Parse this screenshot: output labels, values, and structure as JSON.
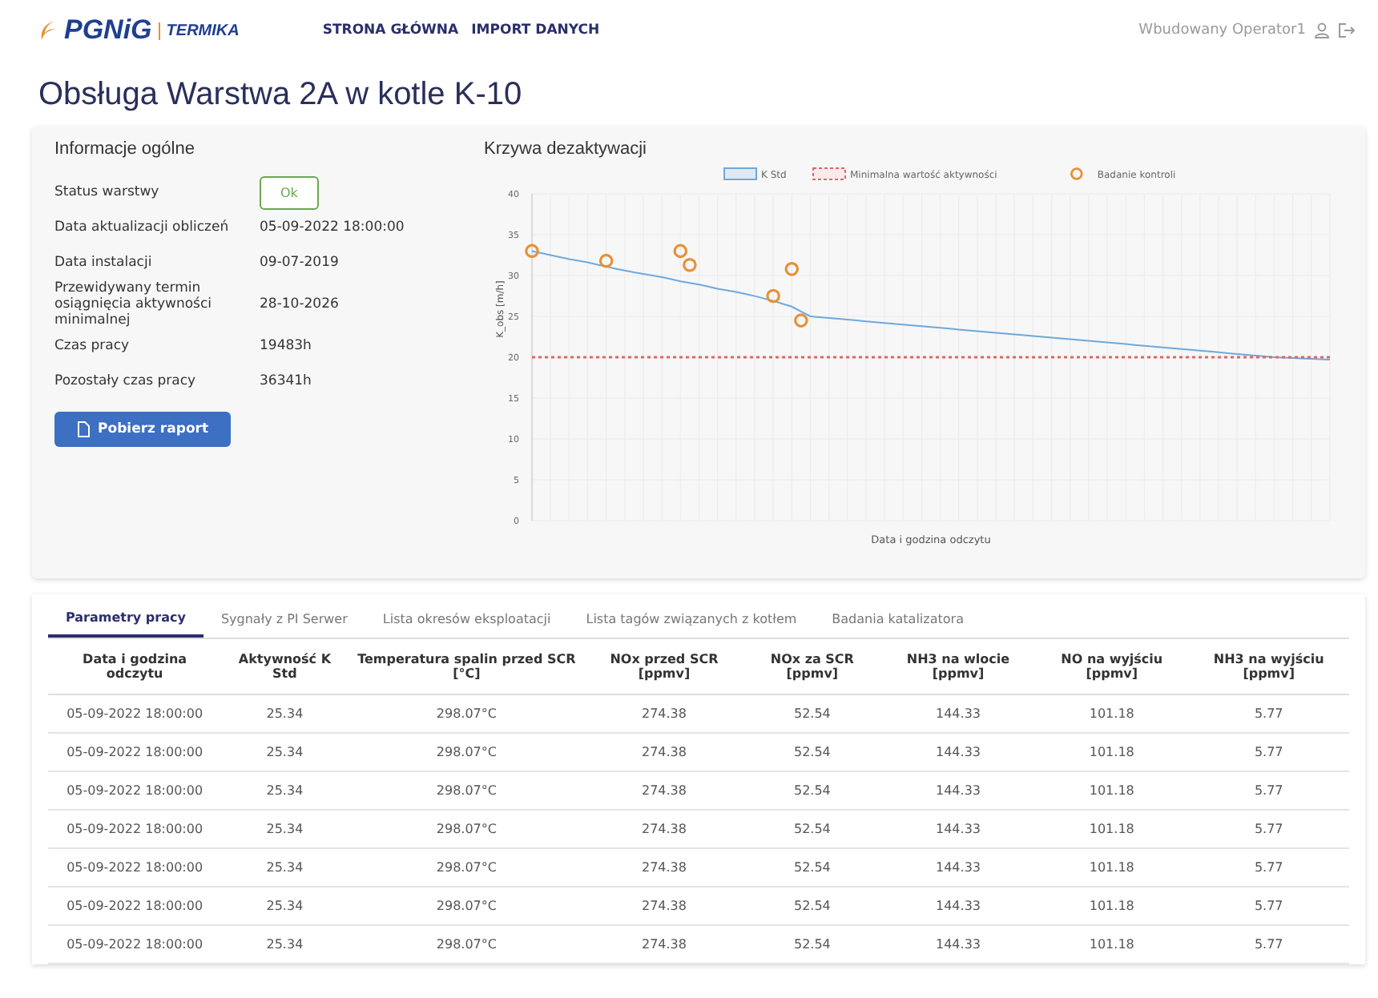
{
  "header": {
    "logo": {
      "brand": "PGNiG",
      "sub": "TERMIKA"
    },
    "nav": [
      {
        "label": "STRONA GŁÓWNA",
        "selected": false
      },
      {
        "label": "IMPORT DANYCH",
        "selected": false
      }
    ],
    "user": "Wbudowany Operator1"
  },
  "page_title": "Obsługa Warstwa 2A w kotle K-10",
  "info": {
    "title": "Informacje ogólne",
    "rows": [
      {
        "label": "Status warstwy",
        "value": "Ok",
        "kind": "badge"
      },
      {
        "label": "Data aktualizacji obliczeń",
        "value": "05-09-2022 18:00:00",
        "kind": "text"
      },
      {
        "label": "Data instalacji",
        "value": "09-07-2019",
        "kind": "text"
      },
      {
        "label": "Przewidywany termin osiągnięcia aktywności minimalnej",
        "value": "28-10-2026",
        "kind": "text"
      },
      {
        "label": "Czas pracy",
        "value": "19483h",
        "kind": "text"
      },
      {
        "label": "Pozostały czas pracy",
        "value": "36341h",
        "kind": "text"
      }
    ],
    "button": "Pobierz raport"
  },
  "chart": {
    "title": "Krzywa dezaktywacji",
    "chart_data": {
      "type": "line",
      "categories": [
        null,
        null,
        null,
        null,
        null,
        null,
        null,
        null,
        null,
        null,
        null,
        null,
        null,
        null,
        null,
        null,
        null,
        null,
        null,
        null,
        null,
        null,
        null,
        null,
        null,
        null,
        null,
        null,
        null,
        null,
        null,
        null,
        null,
        null,
        null,
        null,
        null,
        null,
        null,
        null,
        null,
        null,
        null,
        null,
        null,
        null,
        null,
        null,
        null,
        null,
        null,
        null,
        null,
        null,
        null,
        null,
        null,
        null,
        null,
        null,
        null,
        null,
        null,
        null,
        null,
        null,
        null,
        null,
        null,
        null,
        null,
        null,
        null,
        null,
        null,
        null,
        null,
        null,
        null,
        null,
        null,
        null,
        null,
        null,
        null,
        null,
        null
      ],
      "xlabel": "Data i godzina odczytu",
      "ylabel": "K_obs [m/h]",
      "ylim": [
        0,
        40
      ],
      "grid": true,
      "legend": true,
      "yticks": [
        0,
        5,
        10,
        15,
        20,
        25,
        30,
        35,
        40
      ],
      "series": [
        {
          "name": "K Std",
          "color": "#6fa8dc",
          "type": "line",
          "line_style": "solid",
          "values": [
            33,
            32.75,
            32.5,
            32.25,
            32,
            31.8,
            31.6,
            31.35,
            31.1,
            30.85,
            30.6,
            30.4,
            30.2,
            30,
            29.8,
            29.55,
            29.3,
            29.1,
            28.9,
            28.65,
            28.4,
            28.2,
            28,
            27.75,
            27.5,
            27.2,
            26.9,
            26.55,
            26.2,
            25.6,
            25,
            24.9,
            24.8,
            24.7,
            24.6,
            24.5,
            24.4,
            24.3,
            24.2,
            24.1,
            24,
            23.9,
            23.8,
            23.7,
            23.6,
            23.5,
            23.4,
            23.3,
            23.2,
            23.1,
            23,
            22.9,
            22.8,
            22.7,
            22.6,
            22.5,
            22.4,
            22.3,
            22.2,
            22.1,
            22,
            21.9,
            21.8,
            21.7,
            21.6,
            21.5,
            21.4,
            21.3,
            21.2,
            21.1,
            21,
            20.9,
            20.8,
            20.7,
            20.6,
            20.5,
            20.4,
            20.3,
            20.2,
            20.1,
            20,
            19.95,
            19.9,
            19.85,
            19.8,
            19.75,
            19.7
          ]
        },
        {
          "name": "Minimalna wartość aktywności",
          "color": "#e06666",
          "type": "line",
          "line_style": "dashed",
          "values": [
            20,
            20,
            20,
            20,
            20,
            20,
            20,
            20,
            20,
            20,
            20,
            20,
            20,
            20,
            20,
            20,
            20,
            20,
            20,
            20,
            20,
            20,
            20,
            20,
            20,
            20,
            20,
            20,
            20,
            20,
            20,
            20,
            20,
            20,
            20,
            20,
            20,
            20,
            20,
            20,
            20,
            20,
            20,
            20,
            20,
            20,
            20,
            20,
            20,
            20,
            20,
            20,
            20,
            20,
            20,
            20,
            20,
            20,
            20,
            20,
            20,
            20,
            20,
            20,
            20,
            20,
            20,
            20,
            20,
            20,
            20,
            20,
            20,
            20,
            20,
            20,
            20,
            20,
            20,
            20,
            20,
            20,
            20,
            20,
            20,
            20,
            20
          ]
        },
        {
          "name": "Badanie kontroli",
          "color": "#e69138",
          "type": "scatter",
          "values": [
            33,
            null,
            null,
            null,
            null,
            null,
            null,
            null,
            31.8,
            null,
            null,
            null,
            null,
            null,
            null,
            null,
            33,
            31.3,
            null,
            null,
            null,
            null,
            null,
            null,
            null,
            null,
            27.5,
            null,
            30.8,
            24.5,
            null,
            null,
            null,
            null,
            null,
            null,
            null,
            null,
            null,
            null,
            null,
            null,
            null,
            null,
            null,
            null,
            null,
            null,
            null,
            null,
            null,
            null,
            null,
            null,
            null,
            null,
            null,
            null,
            null,
            null,
            null,
            null,
            null,
            null,
            null,
            null,
            null,
            null,
            null,
            null,
            null,
            null,
            null,
            null,
            null,
            null,
            null,
            null,
            null,
            null,
            null,
            null,
            null,
            null,
            null,
            null,
            null
          ]
        }
      ]
    }
  },
  "tabs": [
    {
      "label": "Parametry pracy",
      "selected": true
    },
    {
      "label": "Sygnały z PI Serwer",
      "selected": false
    },
    {
      "label": "Lista okresów eksploatacji",
      "selected": false
    },
    {
      "label": "Lista tagów związanych z kotłem",
      "selected": false
    },
    {
      "label": "Badania katalizatora",
      "selected": false
    }
  ],
  "table": {
    "columns": [
      "Data i godzina odczytu",
      "Aktywność K Std",
      "Temperatura spalin przed SCR [°C]",
      "NOx przed SCR [ppmv]",
      "NOx za SCR [ppmv]",
      "NH3 na wlocie [ppmv]",
      "NO na wyjściu [ppmv]",
      "NH3 na wyjściu [ppmv]"
    ],
    "rows": [
      [
        "05-09-2022 18:00:00",
        "25.34",
        "298.07°C",
        "274.38",
        "52.54",
        "144.33",
        "101.18",
        "5.77"
      ],
      [
        "05-09-2022 18:00:00",
        "25.34",
        "298.07°C",
        "274.38",
        "52.54",
        "144.33",
        "101.18",
        "5.77"
      ],
      [
        "05-09-2022 18:00:00",
        "25.34",
        "298.07°C",
        "274.38",
        "52.54",
        "144.33",
        "101.18",
        "5.77"
      ],
      [
        "05-09-2022 18:00:00",
        "25.34",
        "298.07°C",
        "274.38",
        "52.54",
        "144.33",
        "101.18",
        "5.77"
      ],
      [
        "05-09-2022 18:00:00",
        "25.34",
        "298.07°C",
        "274.38",
        "52.54",
        "144.33",
        "101.18",
        "5.77"
      ],
      [
        "05-09-2022 18:00:00",
        "25.34",
        "298.07°C",
        "274.38",
        "52.54",
        "144.33",
        "101.18",
        "5.77"
      ],
      [
        "05-09-2022 18:00:00",
        "25.34",
        "298.07°C",
        "274.38",
        "52.54",
        "144.33",
        "101.18",
        "5.77"
      ]
    ]
  }
}
